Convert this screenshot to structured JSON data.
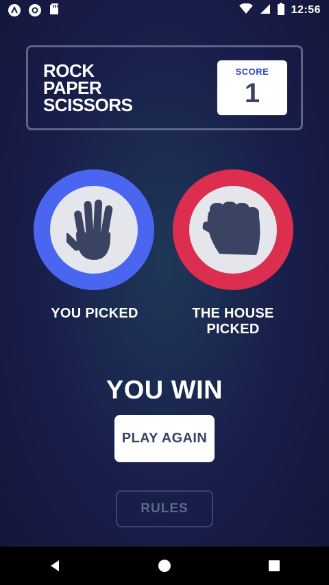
{
  "status_bar": {
    "time": "12:56",
    "left_icons": [
      "android-icon",
      "circle-icon",
      "sd-card-icon"
    ],
    "right_icons": [
      "wifi-icon",
      "signal-icon",
      "battery-icon"
    ]
  },
  "header": {
    "title_lines": [
      "ROCK",
      "PAPER",
      "SCISSORS"
    ],
    "score_label": "SCORE",
    "score_value": "1"
  },
  "picks": {
    "you": {
      "caption": "YOU PICKED",
      "choice": "paper",
      "icon": "hand-paper-icon",
      "ring_color": "#4a66f0"
    },
    "house": {
      "caption": "THE HOUSE PICKED",
      "choice": "rock",
      "icon": "fist-rock-icon",
      "ring_color": "#dc2e4e"
    }
  },
  "result": "YOU WIN",
  "buttons": {
    "play_again": "PLAY AGAIN",
    "rules": "RULES"
  },
  "nav_bar": {
    "buttons": [
      "back-icon",
      "home-icon",
      "recents-icon"
    ]
  }
}
